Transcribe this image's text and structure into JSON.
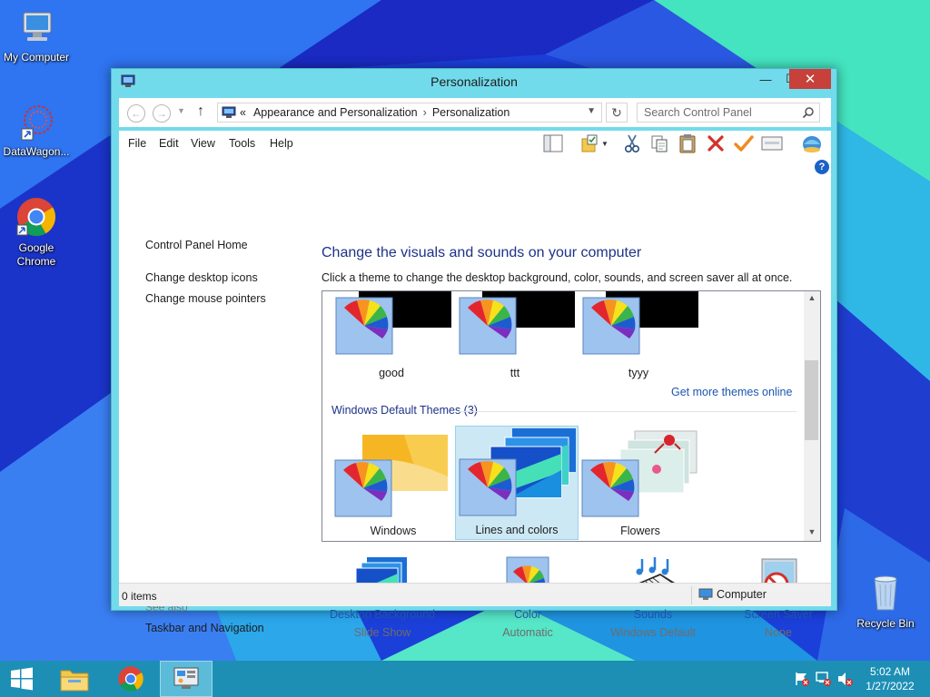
{
  "desktop": {
    "icons": [
      {
        "label": "My Computer",
        "icon": "computer-icon"
      },
      {
        "label": "DataWagon...",
        "icon": "datawagon-icon"
      },
      {
        "label": "Google Chrome",
        "icon": "chrome-icon"
      },
      {
        "label": "Recycle Bin",
        "icon": "recycle-bin-icon"
      }
    ]
  },
  "window": {
    "title": "Personalization",
    "controls": {
      "minimize": "—",
      "maximize": "☐",
      "close": "✕"
    }
  },
  "addressbar": {
    "breadcrumb_prefix": "«",
    "breadcrumb": [
      "Appearance and Personalization",
      "Personalization"
    ],
    "separator": "›",
    "search_placeholder": "Search Control Panel"
  },
  "menu": [
    "File",
    "Edit",
    "View",
    "Tools",
    "Help"
  ],
  "toolbar_icons": [
    "layout-icon",
    "folder-options-icon",
    "cut-icon",
    "copy-icon",
    "paste-icon",
    "delete-icon",
    "check-icon",
    "properties-icon",
    "web-icon"
  ],
  "sidebar": {
    "home": "Control Panel Home",
    "links": [
      "Change desktop icons",
      "Change mouse pointers"
    ],
    "see_also_label": "See also",
    "see_also": [
      "Taskbar and Navigation"
    ]
  },
  "main": {
    "heading": "Change the visuals and sounds on your computer",
    "subtitle": "Click a theme to change the desktop background, color, sounds, and screen saver all at once.",
    "my_themes": [
      "good",
      "ttt",
      "tyyy"
    ],
    "more_themes_link": "Get more themes online",
    "default_header": "Windows Default Themes (3)",
    "default_themes": [
      "Windows",
      "Lines and colors",
      "Flowers"
    ],
    "selected_theme": "Lines and colors"
  },
  "settings": [
    {
      "label": "Desktop Background",
      "value": "Slide Show",
      "icon": "desktop-background-icon"
    },
    {
      "label": "Color",
      "value": "Automatic",
      "icon": "color-icon"
    },
    {
      "label": "Sounds",
      "value": "Windows Default",
      "icon": "sounds-icon"
    },
    {
      "label": "Screen Saver",
      "value": "None",
      "icon": "screen-saver-icon"
    }
  ],
  "statusbar": {
    "items": "0 items",
    "location": "Computer"
  },
  "taskbar": {
    "clock_time": "5:02 AM",
    "clock_date": "1/27/2022"
  },
  "colors": {
    "window_frame": "#72dbeb",
    "close_button": "#c7403a",
    "link": "#1c55b1",
    "heading": "#1e3287",
    "taskbar": "#1d8fb5"
  }
}
